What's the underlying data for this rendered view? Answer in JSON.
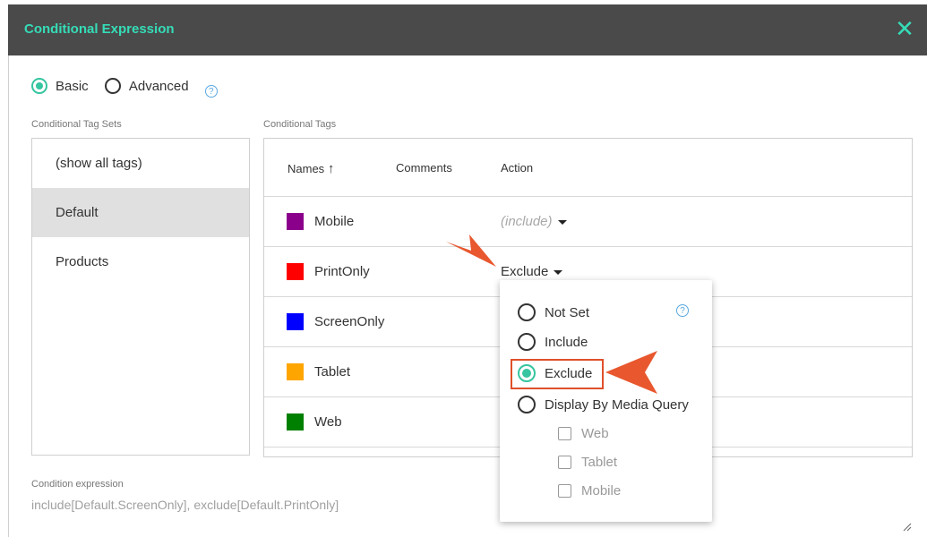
{
  "dialog": {
    "title": "Conditional Expression",
    "close_icon": "close-icon",
    "accent_color": "#35dcb7"
  },
  "mode": {
    "options": [
      "Basic",
      "Advanced"
    ],
    "selected": "Basic"
  },
  "tag_sets": {
    "label": "Conditional Tag Sets",
    "items": [
      "(show all tags)",
      "Default",
      "Products"
    ],
    "selected": "Default"
  },
  "tags": {
    "label": "Conditional Tags",
    "columns": [
      "Names",
      "Comments",
      "Action"
    ],
    "sort_column": "Names",
    "rows": [
      {
        "name": "Mobile",
        "color": "#8b008b",
        "action": "(include)"
      },
      {
        "name": "PrintOnly",
        "color": "#ff0000",
        "action": "Exclude"
      },
      {
        "name": "ScreenOnly",
        "color": "#0000ff",
        "action": ""
      },
      {
        "name": "Tablet",
        "color": "#ffa500",
        "action": ""
      },
      {
        "name": "Web",
        "color": "#008000",
        "action": ""
      }
    ]
  },
  "action_menu": {
    "options": [
      "Not Set",
      "Include",
      "Exclude",
      "Display By Media Query"
    ],
    "selected": "Exclude",
    "media_queries": [
      "Web",
      "Tablet",
      "Mobile"
    ]
  },
  "expression": {
    "label": "Condition expression",
    "value": "include[Default.ScreenOnly], exclude[Default.PrintOnly]"
  }
}
